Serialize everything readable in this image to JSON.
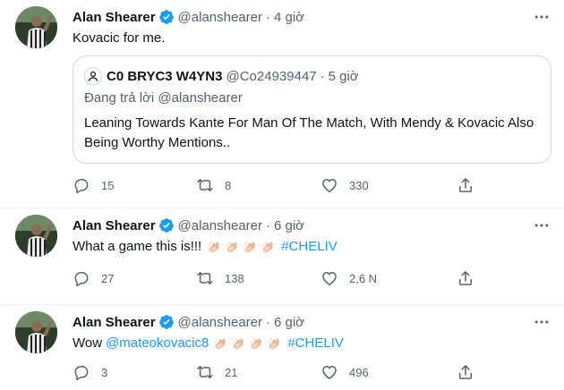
{
  "tweets": [
    {
      "author_name": "Alan Shearer",
      "handle": "@alanshearer",
      "separator": "·",
      "time": "4 giờ",
      "text": "Kovacic for me.",
      "quote": {
        "author_name": "C0 BRYC3 W4YN3",
        "handle": "@Co24939447",
        "separator": "·",
        "time": "5 giờ",
        "reply_to": "Đang trả lời @alanshearer",
        "text": "Leaning Towards Kante For Man Of The Match, With Mendy & Kovacic Also Being Worthy Mentions.."
      },
      "replies": "15",
      "retweets": "8",
      "likes": "330"
    },
    {
      "author_name": "Alan Shearer",
      "handle": "@alanshearer",
      "separator": "·",
      "time": "6 giờ",
      "text": "What a game this is!!!",
      "hashtag": "#CHELIV",
      "emojis": [
        "clapping-hands",
        "clapping-hands",
        "clapping-hands",
        "clapping-hands"
      ],
      "replies": "27",
      "retweets": "138",
      "likes": "2,6 N"
    },
    {
      "author_name": "Alan Shearer",
      "handle": "@alanshearer",
      "separator": "·",
      "time": "6 giờ",
      "text": "Wow",
      "mention": "@mateokovacic8",
      "hashtag": "#CHELIV",
      "emojis": [
        "clapping-hands",
        "clapping-hands",
        "clapping-hands",
        "clapping-hands"
      ],
      "replies": "3",
      "retweets": "21",
      "likes": "496"
    }
  ],
  "colors": {
    "link": "#1d9bf0",
    "secondary_text": "#536471",
    "divider": "#eff3f4",
    "verified": "#1d9bf0"
  },
  "icons": {
    "reply": "speech-bubble-icon",
    "retweet": "retweet-arrows-icon",
    "like": "heart-outline-icon",
    "share": "share-upload-icon",
    "more": "more-dots-icon",
    "verified": "verified-badge-icon"
  }
}
